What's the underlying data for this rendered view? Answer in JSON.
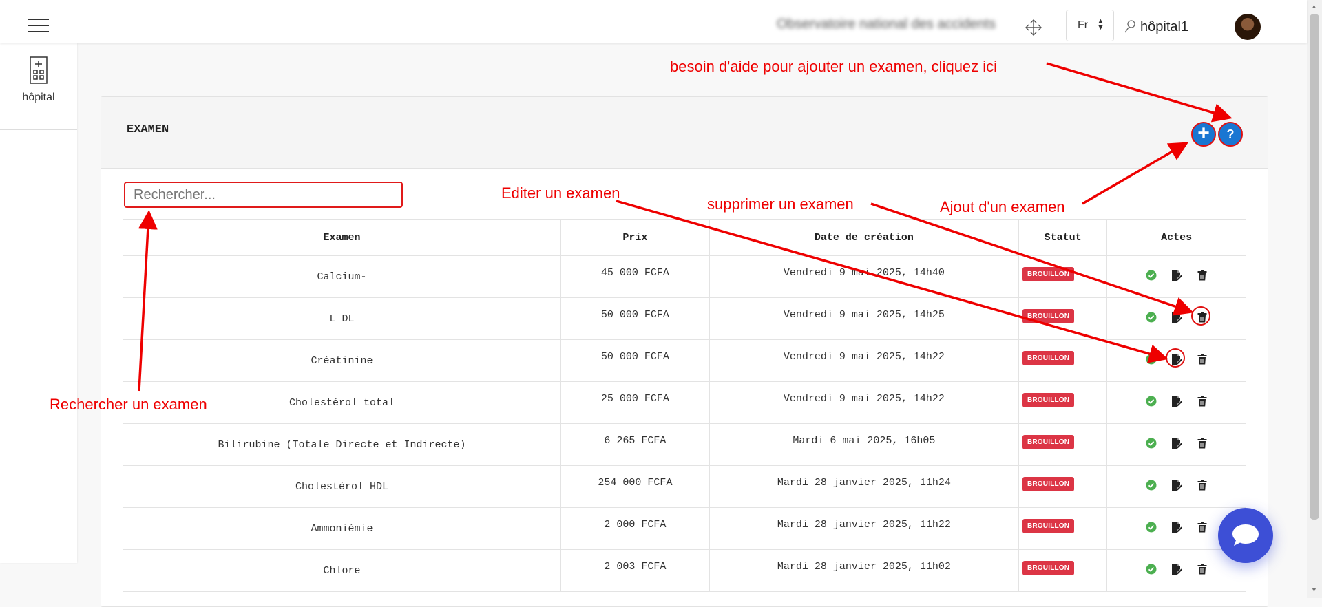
{
  "topbar": {
    "org_name": "Observatoire national des accidents",
    "language": "Fr",
    "username": "hôpital1"
  },
  "sidebar": {
    "items": [
      {
        "label": "hôpital",
        "icon": "hospital-icon"
      }
    ]
  },
  "card": {
    "title": "EXAMEN",
    "add_button": "+",
    "help_button": "?"
  },
  "search": {
    "placeholder": "Rechercher..."
  },
  "table": {
    "headers": {
      "examen": "Examen",
      "prix": "Prix",
      "date": "Date de création",
      "statut": "Statut",
      "actes": "Actes"
    },
    "rows": [
      {
        "examen": "Calcium-",
        "prix": "45 000 FCFA",
        "date": "Vendredi 9 mai 2025, 14h40",
        "statut": "BROUILLON"
      },
      {
        "examen": "L DL",
        "prix": "50 000 FCFA",
        "date": "Vendredi 9 mai 2025, 14h25",
        "statut": "BROUILLON"
      },
      {
        "examen": "Créatinine",
        "prix": "50 000 FCFA",
        "date": "Vendredi 9 mai 2025, 14h22",
        "statut": "BROUILLON"
      },
      {
        "examen": "Cholestérol total",
        "prix": "25 000 FCFA",
        "date": "Vendredi 9 mai 2025, 14h22",
        "statut": "BROUILLON"
      },
      {
        "examen": "Bilirubine (Totale Directe et Indirecte)",
        "prix": "6 265 FCFA",
        "date": "Mardi 6 mai 2025, 16h05",
        "statut": "BROUILLON"
      },
      {
        "examen": "Cholestérol HDL",
        "prix": "254 000 FCFA",
        "date": "Mardi 28 janvier 2025, 11h24",
        "statut": "BROUILLON"
      },
      {
        "examen": "Ammoniémie",
        "prix": "2 000 FCFA",
        "date": "Mardi 28 janvier 2025, 11h22",
        "statut": "BROUILLON"
      },
      {
        "examen": "Chlore",
        "prix": "2 003 FCFA",
        "date": "Mardi 28 janvier 2025, 11h02",
        "statut": "BROUILLON"
      }
    ]
  },
  "annotations": {
    "help": "besoin d'aide pour ajouter un examen, cliquez ici",
    "add": "Ajout d'un examen",
    "edit": "Editer un examen",
    "delete": "supprimer un examen",
    "search": "Rechercher un examen"
  },
  "colors": {
    "annotation": "#e00000",
    "badge": "#dc3545",
    "primary": "#1976d2",
    "validate": "#4caf50",
    "chat": "#3d4fd6"
  }
}
